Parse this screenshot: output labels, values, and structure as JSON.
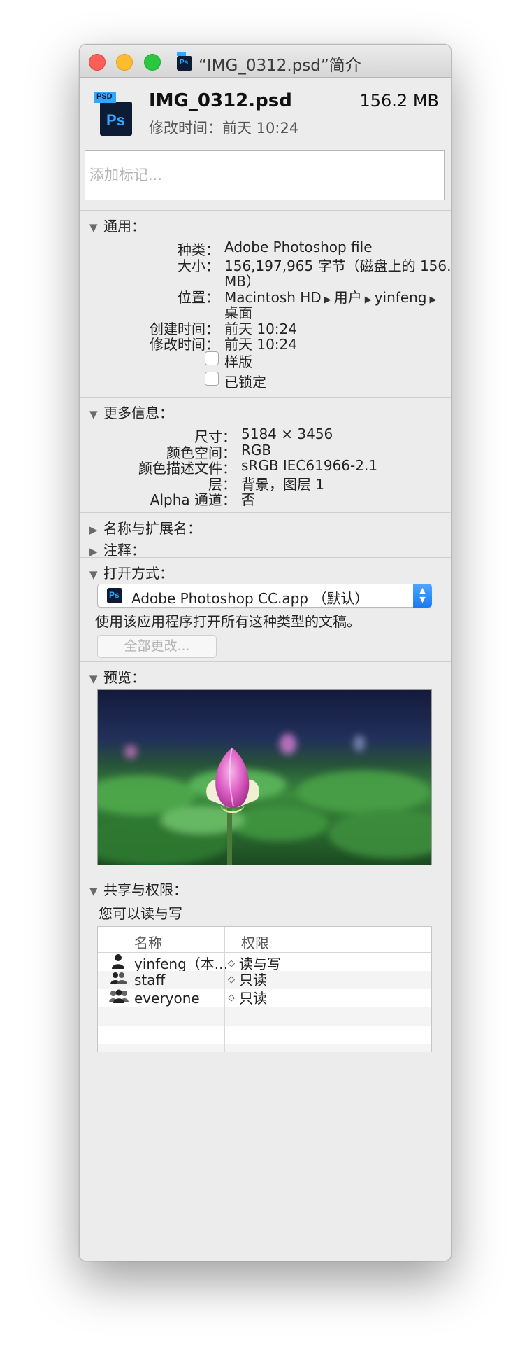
{
  "window": {
    "title": "“IMG_0312.psd”简介"
  },
  "header": {
    "file_name": "IMG_0312.psd",
    "size": "156.2 MB",
    "modified_line": "修改时间：前天 10:24",
    "tags_placeholder": "添加标记..."
  },
  "icons": {
    "file_icon_badge": "PSD",
    "file_icon_letters": "Ps"
  },
  "general": {
    "heading": "通用：",
    "rows": [
      {
        "label": "种类：",
        "value": "Adobe Photoshop file"
      },
      {
        "label": "大小：",
        "value_line1": "156,197,965 字节（磁盘上的 156.2",
        "value_line2": "MB）"
      },
      {
        "label": "位置：",
        "path": [
          "Macintosh HD",
          "用户",
          "yinfeng",
          "桌面"
        ]
      },
      {
        "label": "创建时间：",
        "value": "前天 10:24"
      },
      {
        "label": "修改时间：",
        "value": "前天 10:24"
      }
    ],
    "stationery_label": "样版",
    "locked_label": "已锁定"
  },
  "more_info": {
    "heading": "更多信息：",
    "rows": [
      {
        "label": "尺寸：",
        "value": "5184 × 3456"
      },
      {
        "label": "颜色空间：",
        "value": "RGB"
      },
      {
        "label": "颜色描述文件：",
        "value": "sRGB IEC61966-2.1"
      },
      {
        "label": "层：",
        "value": "背景，图层 1"
      },
      {
        "label": "Alpha 通道：",
        "value": "否"
      }
    ]
  },
  "name_ext": {
    "heading": "名称与扩展名："
  },
  "comments": {
    "heading": "注释："
  },
  "open_with": {
    "heading": "打开方式：",
    "app": "Adobe Photoshop CC.app （默认）",
    "description": "使用该应用程序打开所有这种类型的文稿。",
    "change_all": "全部更改..."
  },
  "preview": {
    "heading": "预览："
  },
  "sharing": {
    "heading": "共享与权限：",
    "summary": "您可以读与写",
    "columns": [
      "名称",
      "权限"
    ],
    "rows": [
      {
        "name": "yinfeng（本...",
        "permission": "读与写"
      },
      {
        "name": "staff",
        "permission": "只读"
      },
      {
        "name": "everyone",
        "permission": "只读"
      }
    ]
  },
  "colors": {
    "close": "#fc5f57",
    "minimize": "#fdbc2e",
    "maximize": "#29c840",
    "photoshop_blue": "#31a8ff",
    "photoshop_dark": "#0d1c34",
    "popup_accent": "#1d79f0"
  }
}
